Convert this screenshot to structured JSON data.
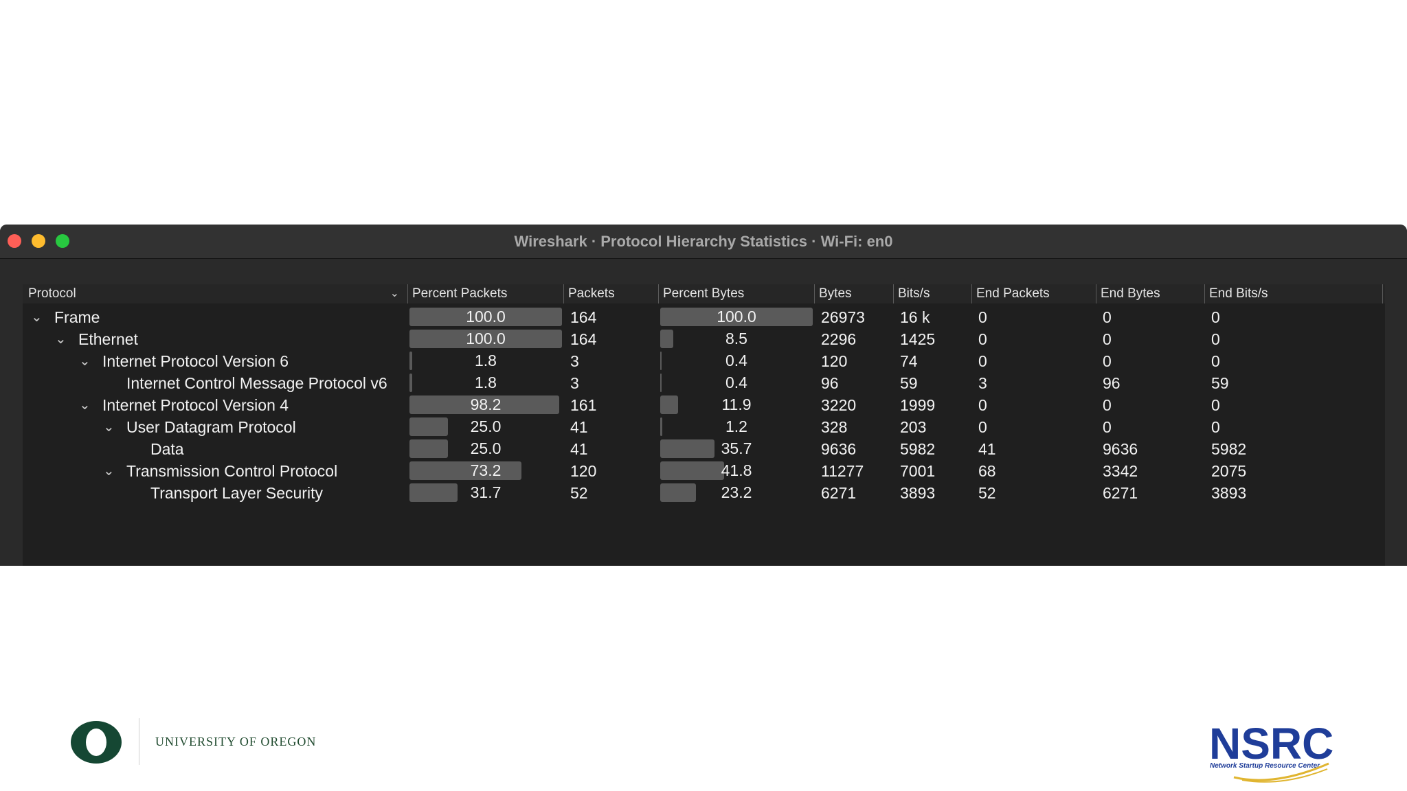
{
  "window": {
    "title": "Wireshark · Protocol Hierarchy Statistics · Wi-Fi: en0"
  },
  "columns": [
    "Protocol",
    "Percent Packets",
    "Packets",
    "Percent Bytes",
    "Bytes",
    "Bits/s",
    "End Packets",
    "End Bytes",
    "End Bits/s"
  ],
  "rows": [
    {
      "protocol": "Frame",
      "depth": 0,
      "expanded": true,
      "percent_packets": "100.0",
      "packets": "164",
      "percent_bytes": "100.0",
      "bytes": "26973",
      "bits_s": "16 k",
      "end_packets": "0",
      "end_bytes": "0",
      "end_bits_s": "0"
    },
    {
      "protocol": "Ethernet",
      "depth": 1,
      "expanded": true,
      "percent_packets": "100.0",
      "packets": "164",
      "percent_bytes": "8.5",
      "bytes": "2296",
      "bits_s": "1425",
      "end_packets": "0",
      "end_bytes": "0",
      "end_bits_s": "0"
    },
    {
      "protocol": "Internet Protocol Version 6",
      "depth": 2,
      "expanded": true,
      "percent_packets": "1.8",
      "packets": "3",
      "percent_bytes": "0.4",
      "bytes": "120",
      "bits_s": "74",
      "end_packets": "0",
      "end_bytes": "0",
      "end_bits_s": "0"
    },
    {
      "protocol": "Internet Control Message Protocol v6",
      "depth": 3,
      "expanded": false,
      "percent_packets": "1.8",
      "packets": "3",
      "percent_bytes": "0.4",
      "bytes": "96",
      "bits_s": "59",
      "end_packets": "3",
      "end_bytes": "96",
      "end_bits_s": "59"
    },
    {
      "protocol": "Internet Protocol Version 4",
      "depth": 2,
      "expanded": true,
      "percent_packets": "98.2",
      "packets": "161",
      "percent_bytes": "11.9",
      "bytes": "3220",
      "bits_s": "1999",
      "end_packets": "0",
      "end_bytes": "0",
      "end_bits_s": "0"
    },
    {
      "protocol": "User Datagram Protocol",
      "depth": 3,
      "expanded": true,
      "percent_packets": "25.0",
      "packets": "41",
      "percent_bytes": "1.2",
      "bytes": "328",
      "bits_s": "203",
      "end_packets": "0",
      "end_bytes": "0",
      "end_bits_s": "0"
    },
    {
      "protocol": "Data",
      "depth": 4,
      "expanded": false,
      "percent_packets": "25.0",
      "packets": "41",
      "percent_bytes": "35.7",
      "bytes": "9636",
      "bits_s": "5982",
      "end_packets": "41",
      "end_bytes": "9636",
      "end_bits_s": "5982"
    },
    {
      "protocol": "Transmission Control Protocol",
      "depth": 3,
      "expanded": true,
      "percent_packets": "73.2",
      "packets": "120",
      "percent_bytes": "41.8",
      "bytes": "11277",
      "bits_s": "7001",
      "end_packets": "68",
      "end_bytes": "3342",
      "end_bits_s": "2075"
    },
    {
      "protocol": "Transport Layer Security",
      "depth": 4,
      "expanded": false,
      "percent_packets": "31.7",
      "packets": "52",
      "percent_bytes": "23.2",
      "bytes": "6271",
      "bits_s": "3893",
      "end_packets": "52",
      "end_bytes": "6271",
      "end_bits_s": "3893"
    }
  ],
  "footer": {
    "university_name": "UNIVERSITY OF OREGON",
    "uo_logo_letter": "O",
    "nsrc_logo_text": "NSRC",
    "nsrc_subtitle": "Network Startup Resource Center"
  },
  "colors": {
    "traffic_red": "#fe5f57",
    "traffic_yellow": "#febc2e",
    "traffic_green": "#28c840",
    "uo_green": "#154733",
    "nsrc_blue": "#1f3d99",
    "nsrc_gold": "#e0b530"
  },
  "icons": {
    "expanded_row": "chevron-down-icon",
    "sort_indicator": "chevron-down-icon"
  }
}
